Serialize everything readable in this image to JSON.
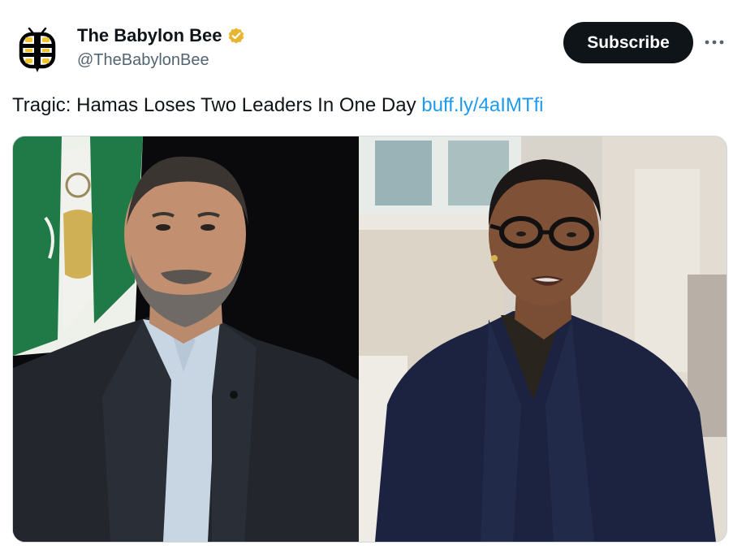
{
  "account": {
    "display_name": "The Babylon Bee",
    "handle": "@TheBabylonBee",
    "avatar_icon": "babylon-bee-logo-icon",
    "verified_icon": "verified-badge-icon",
    "verified_color": "#e8b530"
  },
  "actions": {
    "subscribe_label": "Subscribe",
    "more_icon": "more-options-icon"
  },
  "tweet": {
    "text": "Tragic: Hamas Loses Two Leaders In One Day ",
    "link_text": "buff.ly/4aIMTfi",
    "link_color": "#1d9bf0"
  },
  "media": {
    "photos": [
      {
        "name": "photo-left",
        "description_icon": "man-portrait-image"
      },
      {
        "name": "photo-right",
        "description_icon": "woman-portrait-image"
      }
    ]
  }
}
